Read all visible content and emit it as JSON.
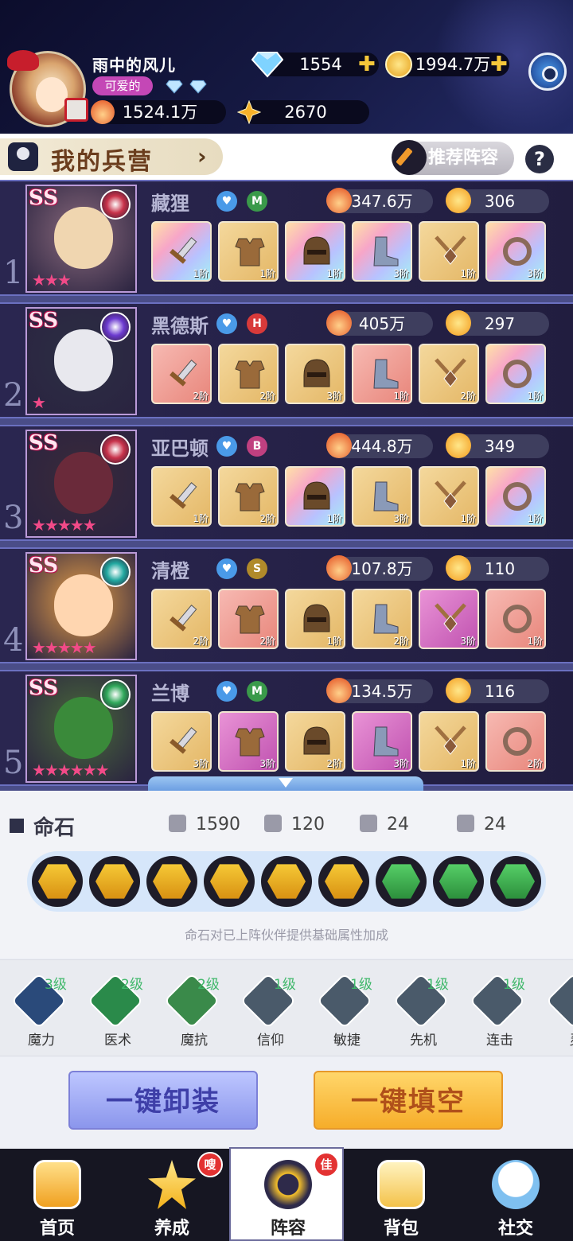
{
  "player": {
    "name": "雨中的风儿",
    "title_badge": "可爱的",
    "diamonds": "1554",
    "gold": "1994.7万",
    "power": "1524.1万",
    "stars": "2670"
  },
  "toolbar": {
    "barracks_label": "我的兵营",
    "recommend_label": "推荐阵容",
    "help_label": "?"
  },
  "heroes": [
    {
      "slot": "1",
      "rank": "SS",
      "name": "藏狸",
      "role": "M",
      "power": "347.6万",
      "level": "306",
      "stars": "★★★",
      "element_color": "#c8324a",
      "equips": [
        {
          "lv": "1阶",
          "bg": "holo",
          "icon": "sword"
        },
        {
          "lv": "1阶",
          "bg": "gold",
          "icon": "armor"
        },
        {
          "lv": "1阶",
          "bg": "holo",
          "icon": "helmet"
        },
        {
          "lv": "3阶",
          "bg": "holo",
          "icon": "boot"
        },
        {
          "lv": "1阶",
          "bg": "gold",
          "icon": "amulet"
        },
        {
          "lv": "3阶",
          "bg": "holo",
          "icon": "ring"
        }
      ]
    },
    {
      "slot": "2",
      "rank": "SS",
      "name": "黑德斯",
      "role": "H",
      "power": "405万",
      "level": "297",
      "stars": "★",
      "element_color": "#6c3ad0",
      "equips": [
        {
          "lv": "2阶",
          "bg": "pinkr",
          "icon": "sword"
        },
        {
          "lv": "2阶",
          "bg": "gold",
          "icon": "armor"
        },
        {
          "lv": "3阶",
          "bg": "gold",
          "icon": "helmet"
        },
        {
          "lv": "1阶",
          "bg": "pinkr",
          "icon": "boot"
        },
        {
          "lv": "2阶",
          "bg": "gold",
          "icon": "amulet"
        },
        {
          "lv": "1阶",
          "bg": "holo",
          "icon": "ring"
        }
      ]
    },
    {
      "slot": "3",
      "rank": "SS",
      "name": "亚巴顿",
      "role": "B",
      "power": "444.8万",
      "level": "349",
      "stars": "★★★★★",
      "element_color": "#c8324a",
      "equips": [
        {
          "lv": "1阶",
          "bg": "gold",
          "icon": "sword"
        },
        {
          "lv": "2阶",
          "bg": "gold",
          "icon": "armor"
        },
        {
          "lv": "1阶",
          "bg": "holo",
          "icon": "helmet"
        },
        {
          "lv": "3阶",
          "bg": "gold",
          "icon": "boot"
        },
        {
          "lv": "1阶",
          "bg": "gold",
          "icon": "amulet"
        },
        {
          "lv": "1阶",
          "bg": "holo",
          "icon": "ring"
        }
      ]
    },
    {
      "slot": "4",
      "rank": "SS",
      "name": "清橙",
      "role": "S",
      "power": "107.8万",
      "level": "110",
      "stars": "★★★★★",
      "element_color": "#22a8a0",
      "equips": [
        {
          "lv": "2阶",
          "bg": "gold",
          "icon": "sword"
        },
        {
          "lv": "2阶",
          "bg": "pinkr",
          "icon": "armor"
        },
        {
          "lv": "1阶",
          "bg": "gold",
          "icon": "helmet"
        },
        {
          "lv": "2阶",
          "bg": "gold",
          "icon": "boot"
        },
        {
          "lv": "3阶",
          "bg": "purp",
          "icon": "amulet"
        },
        {
          "lv": "1阶",
          "bg": "pinkr",
          "icon": "ring"
        }
      ]
    },
    {
      "slot": "5",
      "rank": "SS",
      "name": "兰博",
      "role": "M",
      "power": "134.5万",
      "level": "116",
      "stars": "★★★★★★",
      "element_color": "#2fa85a",
      "equips": [
        {
          "lv": "3阶",
          "bg": "gold",
          "icon": "sword"
        },
        {
          "lv": "3阶",
          "bg": "purp",
          "icon": "armor"
        },
        {
          "lv": "2阶",
          "bg": "gold",
          "icon": "helmet"
        },
        {
          "lv": "3阶",
          "bg": "purp",
          "icon": "boot"
        },
        {
          "lv": "1阶",
          "bg": "gold",
          "icon": "amulet"
        },
        {
          "lv": "2阶",
          "bg": "pinkr",
          "icon": "ring"
        }
      ]
    }
  ],
  "fate_stone": {
    "title": "命石",
    "hp": "1590",
    "attack": "120",
    "defense": "24",
    "magic_defense": "24",
    "note": "命石对已上阵伙伴提供基础属性加成",
    "stones": [
      "gold",
      "gold",
      "gold",
      "gold",
      "gold",
      "gold",
      "green",
      "green",
      "green"
    ]
  },
  "skills": [
    {
      "label": "魔力",
      "level": "3级"
    },
    {
      "label": "医术",
      "level": "2级"
    },
    {
      "label": "魔抗",
      "level": "2级"
    },
    {
      "label": "信仰",
      "level": "1级"
    },
    {
      "label": "敏捷",
      "level": "1级"
    },
    {
      "label": "先机",
      "level": "1级"
    },
    {
      "label": "连击",
      "level": "1级"
    },
    {
      "label": "灵",
      "level": ""
    }
  ],
  "actions": {
    "unequip_all": "一键卸装",
    "fill_all": "一键填空"
  },
  "nav": {
    "home": "首页",
    "train": "养成",
    "lineup": "阵容",
    "bag": "背包",
    "social": "社交",
    "train_badge": "嗖",
    "lineup_badge": "佳"
  }
}
